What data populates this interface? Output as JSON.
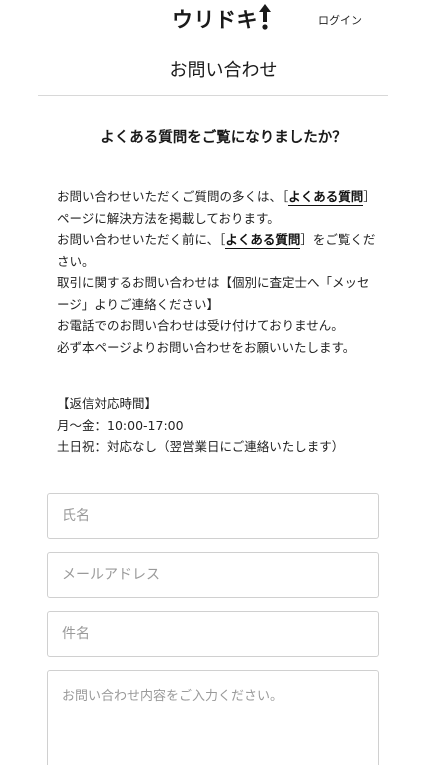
{
  "header": {
    "logo_text": "ウリドキ",
    "login_label": "ログイン"
  },
  "page": {
    "title": "お問い合わせ"
  },
  "faq": {
    "heading": "よくある質問をご覧になりましたか？",
    "line1_pre": "お問い合わせいただくご質問の多くは、［",
    "faq_link_1": "よくある質問",
    "line1_post": "］ページに解決方法を掲載しております。",
    "line2_pre": "お問い合わせいただく前に、［",
    "faq_link_2": "よくある質問",
    "line2_post": "］をご覧ください。",
    "line3": "取引に関するお問い合わせは【個別に査定士へ「メッセージ」よりご連絡ください】",
    "line4": "お電話でのお問い合わせは受け付けておりません。",
    "line5": "必ず本ページよりお問い合わせをお願いいたします。"
  },
  "hours": {
    "title": "【返信対応時間】",
    "weekday": "月〜金：10:00-17:00",
    "weekend": "土日祝：対応なし（翌営業日にご連絡いたします）"
  },
  "form": {
    "name_placeholder": "氏名",
    "email_placeholder": "メールアドレス",
    "subject_placeholder": "件名",
    "message_placeholder": "お問い合わせ内容をご入力ください。"
  }
}
